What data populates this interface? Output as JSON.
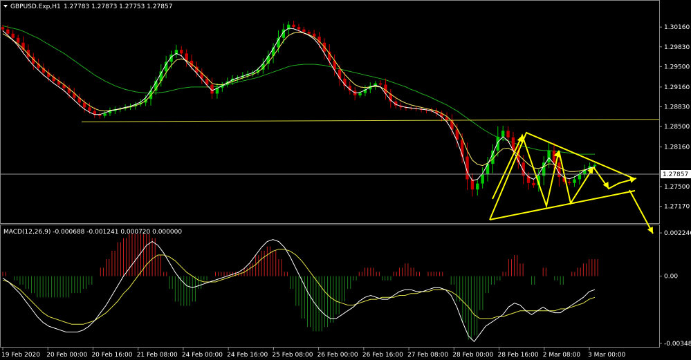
{
  "header": {
    "dropdown_icon": "triangle-down-icon",
    "symbol": "GBPUSD.Exp,H1",
    "ohlc": "1.27783 1.27873 1.27753 1.27857"
  },
  "macd_header": "MACD(12,26,9) -0.000688 -0.001241 0.000720 0.000000",
  "chart_data": {
    "type": "candlestick",
    "price_axis": {
      "ticks": [
        "1.30160",
        "1.29830",
        "1.29500",
        "1.29160",
        "1.28830",
        "1.28500",
        "1.28160",
        "1.27500",
        "1.27170"
      ],
      "current_price_label": "1.27857",
      "range": [
        1.269,
        1.3045
      ]
    },
    "macd_axis": {
      "ticks": [
        "0.002246",
        "0.00",
        "-0.003487"
      ],
      "range": [
        -0.0036,
        0.0025
      ]
    },
    "time_axis": [
      "19 Feb 2020",
      "20 Feb 00:00",
      "20 Feb 16:00",
      "21 Feb 08:00",
      "24 Feb 00:00",
      "24 Feb 16:00",
      "25 Feb 08:00",
      "26 Feb 00:00",
      "26 Feb 16:00",
      "27 Feb 08:00",
      "28 Feb 00:00",
      "28 Feb 16:00",
      "2 Mar 08:00",
      "3 Mar 00:00"
    ],
    "close": [
      1.3012,
      1.3005,
      1.2998,
      1.299,
      1.2978,
      1.2966,
      1.2955,
      1.2948,
      1.294,
      1.2933,
      1.2926,
      1.292,
      1.2914,
      1.2906,
      1.2898,
      1.289,
      1.2882,
      1.2876,
      1.287,
      1.2868,
      1.2872,
      1.2876,
      1.2879,
      1.288,
      1.2882,
      1.2884,
      1.2887,
      1.289,
      1.2896,
      1.291,
      1.2926,
      1.2942,
      1.2958,
      1.297,
      1.2978,
      1.2972,
      1.296,
      1.295,
      1.294,
      1.293,
      1.292,
      1.2905,
      1.2915,
      1.292,
      1.2925,
      1.293,
      1.2932,
      1.2935,
      1.2938,
      1.294,
      1.2945,
      1.2955,
      1.2968,
      1.2982,
      1.2998,
      1.3012,
      1.302,
      1.3016,
      1.3012,
      1.3008,
      1.3005,
      1.3,
      1.299,
      1.2975,
      1.296,
      1.2945,
      1.293,
      1.2918,
      1.291,
      1.2902,
      1.2906,
      1.2912,
      1.2918,
      1.2922,
      1.292,
      1.2905,
      1.2892,
      1.2885,
      1.2882,
      1.2881,
      1.288,
      1.2879,
      1.2878,
      1.2877,
      1.2876,
      1.2872,
      1.2866,
      1.286,
      1.2845,
      1.2828,
      1.28,
      1.2762,
      1.2745,
      1.2755,
      1.277,
      1.2788,
      1.281,
      1.2833,
      1.2843,
      1.2832,
      1.281,
      1.279,
      1.2768,
      1.2756,
      1.2752,
      1.2768,
      1.279,
      1.281,
      1.279,
      1.2766,
      1.2758,
      1.2756,
      1.2762,
      1.277,
      1.2778,
      1.2784,
      1.2786
    ],
    "ma_fast": [
      1.301,
      1.3002,
      1.2994,
      1.2985,
      1.2973,
      1.2962,
      1.2952,
      1.2944,
      1.2936,
      1.2929,
      1.2922,
      1.2916,
      1.291,
      1.2902,
      1.2894,
      1.2886,
      1.2879,
      1.2874,
      1.287,
      1.287,
      1.2873,
      1.2876,
      1.2878,
      1.288,
      1.2882,
      1.2884,
      1.2887,
      1.2891,
      1.2898,
      1.291,
      1.2924,
      1.2939,
      1.2954,
      1.2966,
      1.2972,
      1.2968,
      1.2958,
      1.2948,
      1.2939,
      1.2929,
      1.2919,
      1.291,
      1.2914,
      1.2918,
      1.2923,
      1.2928,
      1.2931,
      1.2934,
      1.2937,
      1.294,
      1.2946,
      1.2955,
      1.2967,
      1.298,
      1.2995,
      1.3008,
      1.3014,
      1.3013,
      1.301,
      1.3006,
      1.3002,
      1.2996,
      1.2986,
      1.2972,
      1.2958,
      1.2944,
      1.2931,
      1.292,
      1.2912,
      1.2906,
      1.2907,
      1.2911,
      1.2916,
      1.2919,
      1.2916,
      1.2905,
      1.2894,
      1.2887,
      1.2884,
      1.2882,
      1.2881,
      1.288,
      1.2879,
      1.2878,
      1.2876,
      1.2872,
      1.2866,
      1.2858,
      1.2844,
      1.2826,
      1.2803,
      1.2774,
      1.276,
      1.2762,
      1.2772,
      1.2787,
      1.2805,
      1.2824,
      1.2833,
      1.2826,
      1.281,
      1.2793,
      1.2776,
      1.2766,
      1.2762,
      1.277,
      1.2785,
      1.2798,
      1.2788,
      1.2772,
      1.2765,
      1.2763,
      1.2766,
      1.2771,
      1.2777,
      1.2781,
      1.2783
    ],
    "ma_mid": [
      1.3005,
      1.3,
      1.2994,
      1.2988,
      1.298,
      1.2971,
      1.2962,
      1.2954,
      1.2946,
      1.2939,
      1.2932,
      1.2926,
      1.292,
      1.2913,
      1.2906,
      1.2898,
      1.2891,
      1.2885,
      1.288,
      1.2877,
      1.2876,
      1.2877,
      1.2878,
      1.2879,
      1.2881,
      1.2883,
      1.2885,
      1.2888,
      1.2893,
      1.2902,
      1.2913,
      1.2926,
      1.294,
      1.2952,
      1.2961,
      1.2963,
      1.296,
      1.2954,
      1.2947,
      1.2939,
      1.2931,
      1.2922,
      1.292,
      1.292,
      1.2922,
      1.2925,
      1.2928,
      1.2931,
      1.2934,
      1.2937,
      1.2941,
      1.2948,
      1.2957,
      1.2968,
      1.298,
      1.2993,
      1.3002,
      1.3006,
      1.3007,
      1.3006,
      1.3003,
      1.2999,
      1.2992,
      1.2983,
      1.2972,
      1.296,
      1.2948,
      1.2937,
      1.2928,
      1.292,
      1.2916,
      1.2915,
      1.2916,
      1.2917,
      1.2916,
      1.2911,
      1.2904,
      1.2898,
      1.2893,
      1.2889,
      1.2886,
      1.2884,
      1.2882,
      1.288,
      1.2878,
      1.2876,
      1.2872,
      1.2867,
      1.2859,
      1.2847,
      1.2831,
      1.281,
      1.2794,
      1.2787,
      1.2785,
      1.2789,
      1.2796,
      1.2806,
      1.2813,
      1.2814,
      1.281,
      1.2803,
      1.2795,
      1.2787,
      1.2781,
      1.278,
      1.2783,
      1.2788,
      1.2787,
      1.2782,
      1.2778,
      1.2775,
      1.2775,
      1.2776,
      1.2778,
      1.278,
      1.2782
    ],
    "ma_slow": [
      1.3018,
      1.3016,
      1.3014,
      1.3012,
      1.3009,
      1.3005,
      1.3001,
      1.2997,
      1.2992,
      1.2987,
      1.2982,
      1.2977,
      1.2972,
      1.2966,
      1.296,
      1.2954,
      1.2948,
      1.2942,
      1.2936,
      1.2931,
      1.2926,
      1.2922,
      1.2918,
      1.2915,
      1.2912,
      1.291,
      1.2908,
      1.2907,
      1.2906,
      1.2906,
      1.2906,
      1.2907,
      1.2908,
      1.291,
      1.2912,
      1.2914,
      1.2915,
      1.2916,
      1.2916,
      1.2916,
      1.2916,
      1.2916,
      1.2917,
      1.2918,
      1.292,
      1.2922,
      1.2924,
      1.2926,
      1.2928,
      1.293,
      1.2932,
      1.2935,
      1.2938,
      1.2941,
      1.2944,
      1.2947,
      1.295,
      1.2952,
      1.2953,
      1.2954,
      1.2954,
      1.2954,
      1.2953,
      1.2952,
      1.295,
      1.2948,
      1.2946,
      1.2944,
      1.2942,
      1.294,
      1.2938,
      1.2936,
      1.2934,
      1.2932,
      1.293,
      1.2928,
      1.2925,
      1.2922,
      1.2919,
      1.2916,
      1.2912,
      1.2909,
      1.2905,
      1.2902,
      1.2898,
      1.2894,
      1.289,
      1.2886,
      1.2881,
      1.2876,
      1.287,
      1.2864,
      1.2858,
      1.2852,
      1.2846,
      1.2841,
      1.2836,
      1.2832,
      1.2829,
      1.2826,
      1.2823,
      1.282,
      1.2817,
      1.2815,
      1.2813,
      1.2811,
      1.281,
      1.281,
      1.2809,
      1.2808,
      1.2807,
      1.2806,
      1.2805,
      1.2804,
      1.2804,
      1.2804,
      1.2804
    ],
    "macd_line": [
      -0.0001,
      -0.0003,
      -0.0006,
      -0.0009,
      -0.0013,
      -0.0017,
      -0.0021,
      -0.0024,
      -0.0026,
      -0.0027,
      -0.0028,
      -0.0029,
      -0.0029,
      -0.0029,
      -0.0028,
      -0.0026,
      -0.0023,
      -0.0019,
      -0.0015,
      -0.001,
      -0.0005,
      0.0,
      0.0004,
      0.0008,
      0.0012,
      0.0016,
      0.0018,
      0.0016,
      0.0012,
      0.0007,
      0.0002,
      -0.0002,
      -0.0005,
      -0.0006,
      -0.0005,
      -0.0004,
      -0.0003,
      -0.0002,
      -0.0001,
      0.0,
      0.0001,
      0.0002,
      0.0004,
      0.0007,
      0.0011,
      0.0015,
      0.0018,
      0.0019,
      0.0018,
      0.0015,
      0.001,
      0.0004,
      -0.0002,
      -0.0008,
      -0.0013,
      -0.0017,
      -0.002,
      -0.0022,
      -0.0022,
      -0.002,
      -0.0018,
      -0.0016,
      -0.0013,
      -0.0011,
      -0.001,
      -0.0011,
      -0.0012,
      -0.0012,
      -0.001,
      -0.0008,
      -0.0007,
      -0.0007,
      -0.0008,
      -0.0008,
      -0.0007,
      -0.0006,
      -0.0006,
      -0.0007,
      -0.001,
      -0.0016,
      -0.0024,
      -0.0031,
      -0.0034,
      -0.003,
      -0.0026,
      -0.0024,
      -0.0022,
      -0.002,
      -0.0016,
      -0.0014,
      -0.0015,
      -0.0018,
      -0.002,
      -0.0018,
      -0.0016,
      -0.0018,
      -0.0019,
      -0.0019,
      -0.0017,
      -0.0015,
      -0.0013,
      -0.0011,
      -0.0008,
      -0.0007
    ],
    "signal_line": [
      -0.0002,
      -0.0003,
      -0.0005,
      -0.0007,
      -0.001,
      -0.0013,
      -0.0016,
      -0.0019,
      -0.0021,
      -0.0022,
      -0.0023,
      -0.0024,
      -0.0025,
      -0.0025,
      -0.0025,
      -0.0024,
      -0.0023,
      -0.0021,
      -0.0019,
      -0.0016,
      -0.0013,
      -0.0009,
      -0.0006,
      -0.0002,
      0.0002,
      0.0006,
      0.0009,
      0.0011,
      0.0011,
      0.001,
      0.0008,
      0.0005,
      0.0002,
      0.0,
      -0.0002,
      -0.0003,
      -0.0003,
      -0.0003,
      -0.0002,
      -0.0001,
      0.0,
      0.0001,
      0.0002,
      0.0004,
      0.0006,
      0.0009,
      0.0011,
      0.0013,
      0.0014,
      0.0014,
      0.0013,
      0.0011,
      0.0008,
      0.0004,
      0.0,
      -0.0004,
      -0.0008,
      -0.0011,
      -0.0013,
      -0.0014,
      -0.0015,
      -0.0015,
      -0.0014,
      -0.0013,
      -0.0012,
      -0.0012,
      -0.0011,
      -0.0011,
      -0.0011,
      -0.001,
      -0.001,
      -0.0009,
      -0.0009,
      -0.0008,
      -0.0008,
      -0.0007,
      -0.0007,
      -0.0007,
      -0.0008,
      -0.001,
      -0.0013,
      -0.0016,
      -0.002,
      -0.0022,
      -0.0022,
      -0.0022,
      -0.0021,
      -0.0021,
      -0.002,
      -0.0019,
      -0.0018,
      -0.0018,
      -0.0018,
      -0.0018,
      -0.0018,
      -0.0018,
      -0.0018,
      -0.0017,
      -0.0017,
      -0.0016,
      -0.0015,
      -0.0014,
      -0.0012,
      -0.0011
    ],
    "colors": {
      "bull": "#00cc00",
      "bear": "#cc0000",
      "ma_fast": "#ffffff",
      "ma_mid": "#e6e64d",
      "ma_violet": "#9b4dff",
      "ma_slow": "#22aa22",
      "support": "#d4d43a",
      "pattern": "#ffff00",
      "macd_line": "#ffffff",
      "signal_line": "#e6e64d",
      "hist_pos": "#cc2020",
      "hist_neg": "#208020",
      "grid": "#9a9a9a"
    },
    "grid": false
  }
}
